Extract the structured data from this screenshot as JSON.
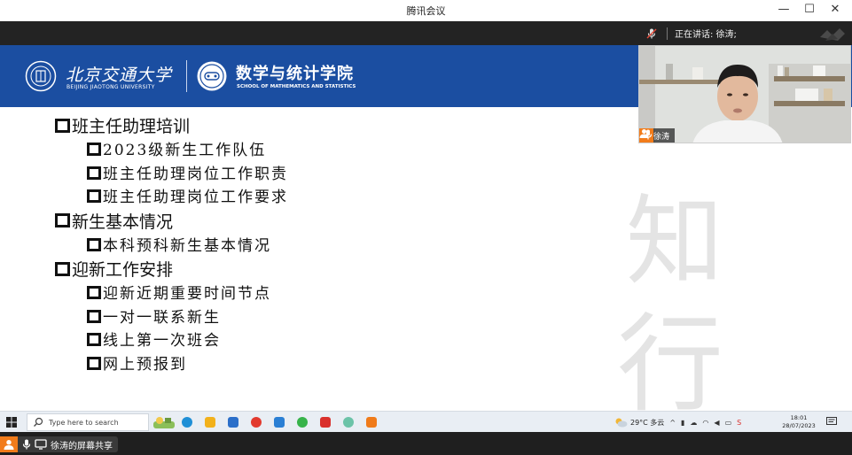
{
  "window": {
    "title": "腾讯会议",
    "minimize": "—",
    "maximize": "☐",
    "close": "✕"
  },
  "meeting_bar": {
    "speaking_label": "正在讲话: 徐涛;"
  },
  "slide": {
    "banner": {
      "university_cn": "北京交通大学",
      "university_en": "BEIJING JIAOTONG UNIVERSITY",
      "school_cn": "数学与统计学院",
      "school_en": "SCHOOL OF MATHEMATICS AND STATISTICS"
    },
    "outline": [
      {
        "title": "班主任助理培训",
        "items": [
          "2023级新生工作队伍",
          "班主任助理岗位工作职责",
          "班主任助理岗位工作要求"
        ]
      },
      {
        "title": "新生基本情况",
        "items": [
          "本科预科新生基本情况"
        ]
      },
      {
        "title": "迎新工作安排",
        "items": [
          "迎新近期重要时间节点",
          "一对一联系新生",
          "线上第一次班会",
          "网上预报到"
        ]
      }
    ],
    "watermark": "知行"
  },
  "video": {
    "participant_name": "徐涛"
  },
  "taskbar": {
    "search_placeholder": "Type here to search",
    "weather": "29°C 多云",
    "time": "18:01",
    "date": "28/07/2023",
    "apps": [
      {
        "icon": "edge-icon",
        "color": "#1f8fd6"
      },
      {
        "icon": "file-explorer-icon",
        "color": "#f2b11b"
      },
      {
        "icon": "mail-icon",
        "color": "#2b6fc9"
      },
      {
        "icon": "browser-icon",
        "color": "#e23a2e"
      },
      {
        "icon": "photos-icon",
        "color": "#2a7fd4"
      },
      {
        "icon": "wechat-icon",
        "color": "#37b34a"
      },
      {
        "icon": "wps-icon",
        "color": "#d9302c"
      },
      {
        "icon": "cloud-icon",
        "color": "#6cc3a8"
      },
      {
        "icon": "tencent-meeting-icon",
        "color": "#f07b1a"
      }
    ]
  },
  "share_bar": {
    "label": "徐涛的屏幕共享"
  }
}
